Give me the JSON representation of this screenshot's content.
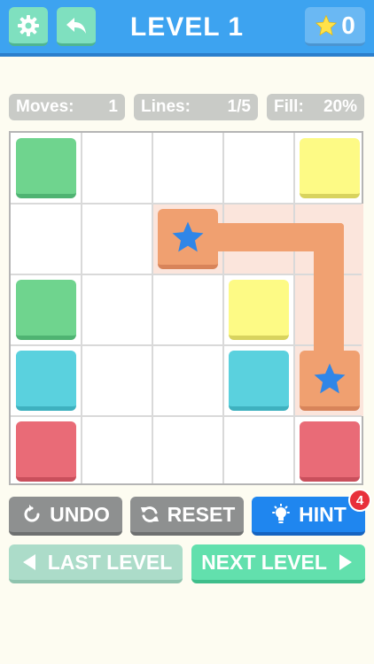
{
  "header": {
    "title": "LEVEL 1",
    "star_count": "0",
    "icons": {
      "settings": "gear-icon",
      "back": "back-arrow-icon",
      "star": "star-icon"
    }
  },
  "stats": {
    "moves_label": "Moves:",
    "moves_value": "1",
    "lines_label": "Lines:",
    "lines_value": "1/5",
    "fill_label": "Fill:",
    "fill_value": "20%"
  },
  "board": {
    "rows": 5,
    "cols": 5,
    "tiles": [
      {
        "row": 0,
        "col": 0,
        "color": "green"
      },
      {
        "row": 0,
        "col": 4,
        "color": "yellow"
      },
      {
        "row": 1,
        "col": 2,
        "color": "orange",
        "connected": true
      },
      {
        "row": 2,
        "col": 0,
        "color": "green"
      },
      {
        "row": 2,
        "col": 3,
        "color": "yellow"
      },
      {
        "row": 3,
        "col": 0,
        "color": "cyan"
      },
      {
        "row": 3,
        "col": 3,
        "color": "cyan"
      },
      {
        "row": 3,
        "col": 4,
        "color": "orange",
        "connected": true
      },
      {
        "row": 4,
        "col": 0,
        "color": "red"
      },
      {
        "row": 4,
        "col": 4,
        "color": "red"
      }
    ],
    "colors": {
      "green": "#6fd48e",
      "yellow": "#fdfa85",
      "orange": "#f0a070",
      "cyan": "#5ad1de",
      "red": "#e96b77",
      "star": "#2f86e8"
    }
  },
  "controls": {
    "undo_label": "UNDO",
    "reset_label": "RESET",
    "hint_label": "HINT",
    "hint_badge": "4",
    "last_level_label": "LAST LEVEL",
    "next_level_label": "NEXT LEVEL"
  },
  "theme": {
    "header_blue": "#3da3f0",
    "mint": "#7fe0bf",
    "gray_button": "#8e9090",
    "hint_blue": "#1f86ef"
  }
}
